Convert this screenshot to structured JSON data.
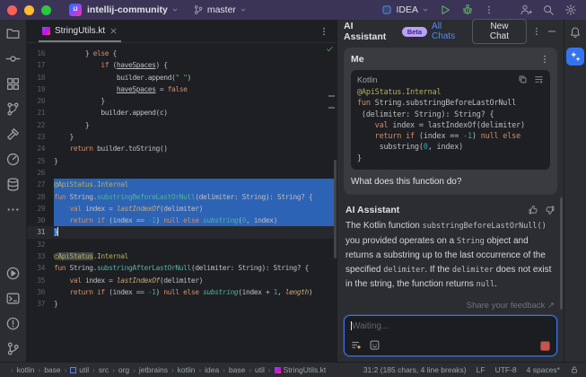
{
  "colors": {
    "accent": "#3574f0",
    "selection": "#2d63b4",
    "titlebar": "#3b3456",
    "beta_badge": "#b9a1f7",
    "stop_button": "#c75450",
    "run_green": "#5fad65",
    "settings_notification_dot": "#e8a33d"
  },
  "titlebar": {
    "project": "intellij-community",
    "branch": "master",
    "run_config": "IDEA"
  },
  "left_toolbar": {
    "top": [
      {
        "name": "project",
        "icon": "folder"
      },
      {
        "name": "commit",
        "icon": "commit"
      },
      {
        "name": "structure",
        "icon": "structure"
      },
      {
        "name": "pull-requests",
        "icon": "vcs"
      },
      {
        "name": "build",
        "icon": "hammer"
      },
      {
        "name": "services",
        "icon": "gauge"
      },
      {
        "name": "database",
        "icon": "database"
      },
      {
        "name": "more-tool-windows",
        "icon": "more-h"
      }
    ],
    "bottom": [
      {
        "name": "run",
        "icon": "run-circle"
      },
      {
        "name": "terminal",
        "icon": "terminal"
      },
      {
        "name": "problems",
        "icon": "problems"
      },
      {
        "name": "version-control",
        "icon": "branch"
      }
    ]
  },
  "right_toolbar": [
    {
      "name": "notifications",
      "icon": "bell"
    }
  ],
  "editor": {
    "tab": "StringUtils.kt",
    "lines": [
      {
        "n": 16,
        "m": "",
        "t": [
          [
            "d",
            "        } "
          ],
          [
            "k",
            "else"
          ],
          [
            "d",
            " {"
          ]
        ]
      },
      {
        "n": 17,
        "m": "",
        "t": [
          [
            "d",
            "            "
          ],
          [
            "k",
            "if"
          ],
          [
            "d",
            " ("
          ],
          [
            "u",
            "haveSpaces"
          ],
          [
            "d",
            ") {"
          ]
        ]
      },
      {
        "n": 18,
        "m": "",
        "t": [
          [
            "d",
            "                builder.append("
          ],
          [
            "s",
            "\" \""
          ],
          [
            "d",
            ")"
          ]
        ]
      },
      {
        "n": 19,
        "m": "",
        "t": [
          [
            "d",
            "                "
          ],
          [
            "u",
            "haveSpaces"
          ],
          [
            "d",
            " = "
          ],
          [
            "k",
            "false"
          ]
        ]
      },
      {
        "n": 20,
        "m": "",
        "t": [
          [
            "d",
            "            }"
          ]
        ]
      },
      {
        "n": 21,
        "m": "",
        "t": [
          [
            "d",
            "            builder.append(c)"
          ]
        ]
      },
      {
        "n": 22,
        "m": "",
        "t": [
          [
            "d",
            "        }"
          ]
        ]
      },
      {
        "n": 23,
        "m": "",
        "t": [
          [
            "d",
            "    }"
          ]
        ]
      },
      {
        "n": 24,
        "m": "",
        "t": [
          [
            "d",
            "    "
          ],
          [
            "k",
            "return"
          ],
          [
            "d",
            " builder.toString()"
          ]
        ]
      },
      {
        "n": 25,
        "m": "",
        "t": [
          [
            "d",
            "}"
          ]
        ]
      },
      {
        "n": 26,
        "m": "",
        "t": []
      },
      {
        "n": 27,
        "m": "sel",
        "t": [
          [
            "a",
            "@ApiStatus.Internal"
          ]
        ]
      },
      {
        "n": 28,
        "m": "sel",
        "t": [
          [
            "k",
            "fun"
          ],
          [
            "d",
            " String."
          ],
          [
            "f",
            "substringBeforeLastOrNull"
          ],
          [
            "d",
            "(delimiter: String): String? {"
          ]
        ]
      },
      {
        "n": 29,
        "m": "sel",
        "t": [
          [
            "d",
            "    "
          ],
          [
            "k",
            "val"
          ],
          [
            "d",
            " index = "
          ],
          [
            "c",
            "lastIndexOf"
          ],
          [
            "d",
            "(delimiter)"
          ]
        ]
      },
      {
        "n": 30,
        "m": "sel",
        "t": [
          [
            "d",
            "    "
          ],
          [
            "k",
            "return"
          ],
          [
            "d",
            " "
          ],
          [
            "k",
            "if"
          ],
          [
            "d",
            " (index == "
          ],
          [
            "n2",
            "-1"
          ],
          [
            "d",
            ") "
          ],
          [
            "k",
            "null"
          ],
          [
            "d",
            " "
          ],
          [
            "k",
            "else"
          ],
          [
            "d",
            " "
          ],
          [
            "e",
            "substring"
          ],
          [
            "d",
            "("
          ],
          [
            "n2",
            "0"
          ],
          [
            "d",
            ", index)"
          ]
        ]
      },
      {
        "n": 31,
        "m": "cur",
        "caret": true,
        "t": [
          [
            "x",
            "}"
          ]
        ]
      },
      {
        "n": 32,
        "m": "",
        "t": []
      },
      {
        "n": 33,
        "m": "",
        "t": [
          [
            "a",
            "@"
          ],
          [
            "h",
            "ApiStatus"
          ],
          [
            "a",
            ".Internal"
          ]
        ]
      },
      {
        "n": 34,
        "m": "",
        "t": [
          [
            "k",
            "fun"
          ],
          [
            "d",
            " String."
          ],
          [
            "f",
            "substringAfterLastOrNull"
          ],
          [
            "d",
            "(delimiter: String): String? {"
          ]
        ]
      },
      {
        "n": 35,
        "m": "",
        "t": [
          [
            "d",
            "    "
          ],
          [
            "k",
            "val"
          ],
          [
            "d",
            " index = "
          ],
          [
            "c",
            "lastIndexOf"
          ],
          [
            "d",
            "(delimiter)"
          ]
        ]
      },
      {
        "n": 36,
        "m": "",
        "t": [
          [
            "d",
            "    "
          ],
          [
            "k",
            "return"
          ],
          [
            "d",
            " "
          ],
          [
            "k",
            "if"
          ],
          [
            "d",
            " (index == "
          ],
          [
            "n2",
            "-1"
          ],
          [
            "d",
            ") "
          ],
          [
            "k",
            "null"
          ],
          [
            "d",
            " "
          ],
          [
            "k",
            "else"
          ],
          [
            "d",
            " "
          ],
          [
            "e",
            "substring"
          ],
          [
            "d",
            "(index + "
          ],
          [
            "n2",
            "1"
          ],
          [
            "d",
            ", "
          ],
          [
            "c",
            "length"
          ],
          [
            "d",
            ")"
          ]
        ]
      },
      {
        "n": 37,
        "m": "",
        "t": [
          [
            "d",
            "}"
          ]
        ]
      }
    ]
  },
  "ai": {
    "title": "AI Assistant",
    "beta": "Beta",
    "all_chats": "All Chats",
    "new_chat": "New Chat",
    "me_label": "Me",
    "code_lang": "Kotlin",
    "code_lines": [
      [
        [
          "a",
          "@ApiStatus.Internal"
        ]
      ],
      [
        [
          "k",
          "fun"
        ],
        [
          "d",
          " String.substringBeforeLastOrNull"
        ]
      ],
      [
        [
          "d",
          " (delimiter: String): String? {"
        ]
      ],
      [
        [
          "d",
          "    "
        ],
        [
          "k",
          "val"
        ],
        [
          "d",
          " index = lastIndexOf(delimiter)"
        ]
      ],
      [
        [
          "d",
          "    "
        ],
        [
          "k",
          "return"
        ],
        [
          "d",
          " "
        ],
        [
          "k",
          "if"
        ],
        [
          "d",
          " (index == "
        ],
        [
          "n2",
          "-1"
        ],
        [
          "d",
          ") "
        ],
        [
          "k",
          "null"
        ],
        [
          "d",
          " "
        ],
        [
          "k",
          "else"
        ]
      ],
      [
        [
          "d",
          "     substring("
        ],
        [
          "n2",
          "0"
        ],
        [
          "d",
          ", index)"
        ]
      ],
      [
        [
          "d",
          "}"
        ]
      ]
    ],
    "question": "What does this function do?",
    "assistant_label": "AI Assistant",
    "response": [
      [
        "t",
        "The Kotlin function "
      ],
      [
        "c",
        "substringBeforeLastOrNull()"
      ],
      [
        "t",
        " you provided operates on a "
      ],
      [
        "c",
        "String"
      ],
      [
        "t",
        " object and returns a substring up to the last occurrence of the specified "
      ],
      [
        "c",
        "delimiter"
      ],
      [
        "t",
        ". If the "
      ],
      [
        "c",
        "delimiter"
      ],
      [
        "t",
        " does not exist in the string, the function returns "
      ],
      [
        "c",
        "null"
      ],
      [
        "t",
        "."
      ]
    ],
    "feedback": "Share your feedback ↗",
    "input_placeholder": "Waiting..."
  },
  "status": {
    "breadcrumbs": [
      {
        "label": "kotlin"
      },
      {
        "label": "base"
      },
      {
        "label": "util",
        "icon": "module"
      },
      {
        "label": "src"
      },
      {
        "label": "org"
      },
      {
        "label": "jetbrains"
      },
      {
        "label": "kotlin"
      },
      {
        "label": "idea"
      },
      {
        "label": "base"
      },
      {
        "label": "util"
      },
      {
        "label": "StringUtils.kt",
        "icon": "kotlin"
      }
    ],
    "position": "31:2 (185 chars, 4 line breaks)",
    "line_separator": "LF",
    "encoding": "UTF-8",
    "indent": "4 spaces*"
  }
}
